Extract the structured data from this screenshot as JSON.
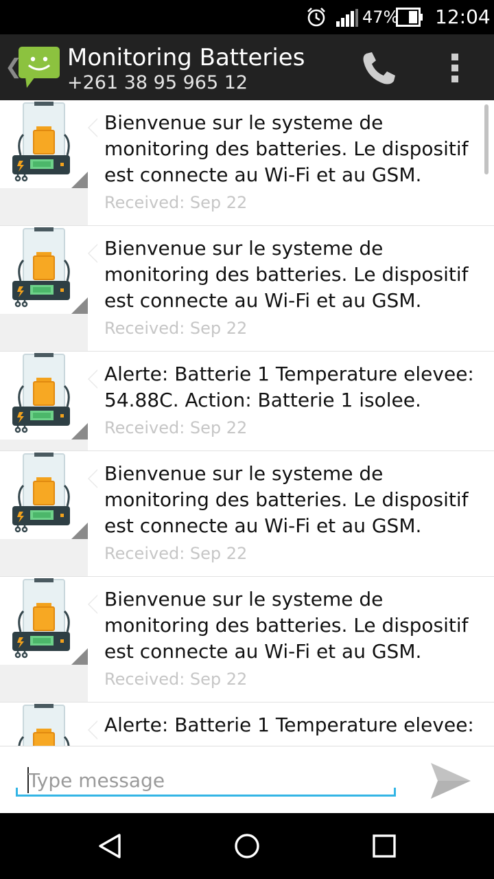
{
  "status_bar": {
    "battery_percent": "47%",
    "time": "12:04",
    "icons": [
      "alarm-icon",
      "signal-icon",
      "battery-icon"
    ]
  },
  "header": {
    "back_glyph": "❮",
    "title": "Monitoring Batteries",
    "subtitle": "+261 38 95 965 12",
    "icons": [
      "app-icon",
      "call-icon",
      "overflow-menu-icon"
    ],
    "app_icon_color": "#8cc23f"
  },
  "messages": [
    {
      "text": "Bienvenue sur le systeme de monitoring des batteries. Le dispositif est connecte au Wi-Fi et au GSM.",
      "meta": "Received: Sep 22"
    },
    {
      "text": "Bienvenue sur le systeme de monitoring des batteries. Le dispositif est connecte au Wi-Fi et au GSM.",
      "meta": "Received: Sep 22"
    },
    {
      "text": "Alerte: Batterie 1 Temperature elevee: 54.88C. Action: Batterie 1 isolee.",
      "meta": "Received: Sep 22"
    },
    {
      "text": "Bienvenue sur le systeme de monitoring des batteries. Le dispositif est connecte au Wi-Fi et au GSM.",
      "meta": "Received: Sep 22"
    },
    {
      "text": "Bienvenue sur le systeme de monitoring des batteries. Le dispositif est connecte au Wi-Fi et au GSM.",
      "meta": "Received: Sep 22"
    },
    {
      "text": "Alerte: Batterie 1 Temperature elevee:",
      "meta": ""
    }
  ],
  "compose": {
    "placeholder": "Type message",
    "value": "",
    "accent_color": "#33b5e5"
  },
  "nav": {
    "icons": [
      "back-icon",
      "home-icon",
      "recents-icon"
    ]
  }
}
